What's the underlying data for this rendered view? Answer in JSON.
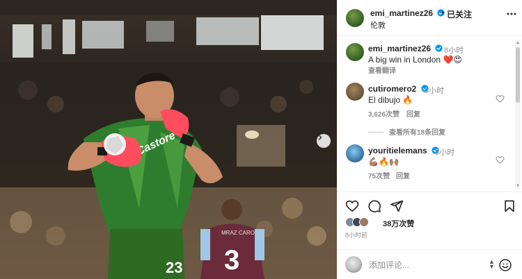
{
  "post": {
    "username": "emi_martinez26",
    "follow_status": "已关注",
    "dot": "•",
    "location": "伦敦"
  },
  "photo": {
    "jersey_number_back": "3",
    "jersey_name_back": "MRAZ CARO",
    "shorts_number": "23",
    "shirt_sponsor": "Castore"
  },
  "caption": {
    "username": "emi_martinez26",
    "time": "8小时",
    "text": "A big win in London",
    "emojis": "❤️😍",
    "translate": "查看翻译"
  },
  "comments": [
    {
      "username": "cutiromero2",
      "time": "8小时",
      "text": "El dibujo",
      "emoji": "🔥",
      "likes": "3,626次赞",
      "reply": "回复",
      "view_replies": "查看所有18条回复"
    },
    {
      "username": "youritielemans",
      "time": "6小时",
      "text": "",
      "emoji": "💪🏽🔥🙌🏽",
      "likes": "75次赞",
      "reply": "回复"
    }
  ],
  "actions": {
    "likes_count": "38万次赞",
    "posted_time": "8小时前",
    "comment_placeholder": "添加评论..."
  },
  "icons": {
    "verified": "verified-badge-icon",
    "more": "more-options-icon",
    "like": "heart-icon",
    "comment": "comment-icon",
    "share": "share-icon",
    "save": "bookmark-icon",
    "emoji": "emoji-icon",
    "next": "chevron-right-icon"
  },
  "colors": {
    "verified_blue": "#0095f6",
    "jersey_green": "#2e7d2e",
    "glove_pink": "#ff4d5e",
    "villa_claret": "#6b2b3a"
  }
}
